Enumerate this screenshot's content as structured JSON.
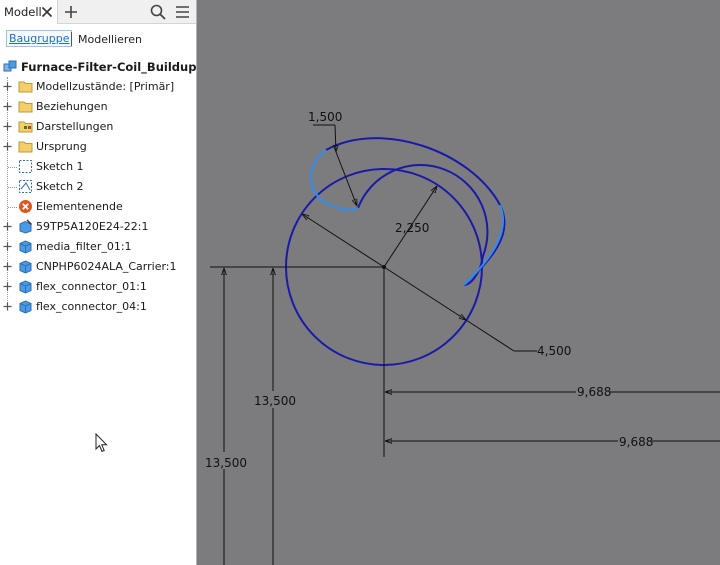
{
  "tabs": {
    "model_label": "Modell"
  },
  "modes": {
    "assembly_label": "Baugruppe",
    "model_label": "Modellieren"
  },
  "tree": {
    "root_label": "Furnace-Filter-Coil_Buildup.iam",
    "items": [
      {
        "label": "Modellzustände: [Primär]",
        "icon": "folder-icon",
        "expandable": true
      },
      {
        "label": "Beziehungen",
        "icon": "folder-icon",
        "expandable": true
      },
      {
        "label": "Darstellungen",
        "icon": "representations-folder-icon",
        "expandable": true
      },
      {
        "label": "Ursprung",
        "icon": "folder-icon",
        "expandable": true
      },
      {
        "label": "Sketch 1",
        "icon": "sketch-icon",
        "expandable": false
      },
      {
        "label": "Sketch 2",
        "icon": "sketch-icon",
        "expandable": false
      },
      {
        "label": "Elementenende",
        "icon": "end-of-features-icon",
        "expandable": false
      },
      {
        "label": "59TP5A120E24-22:1",
        "icon": "edited-part-icon",
        "expandable": true
      },
      {
        "label": "media_filter_01:1",
        "icon": "part-icon",
        "expandable": true
      },
      {
        "label": "CNPHP6024ALA_Carrier:1",
        "icon": "part-icon",
        "expandable": true
      },
      {
        "label": "flex_connector_01:1",
        "icon": "part-icon",
        "expandable": true
      },
      {
        "label": "flex_connector_04:1",
        "icon": "part-icon",
        "expandable": true
      }
    ]
  },
  "sketch": {
    "dimensions": {
      "slot_width": "1,500",
      "inner_radius": "2,250",
      "outer_diameter": "4,500",
      "vertical_a": "13,500",
      "vertical_b": "13,500",
      "horizontal_a": "9,688",
      "horizontal_b": "9,688"
    }
  },
  "colors": {
    "canvas": "#7c7c7f",
    "sketch_blue": "#1a1aa8",
    "highlight_blue": "#2f8ef0",
    "dim_line": "#111111",
    "folder": "#f2cf6b",
    "part": "#4a9be6",
    "link": "#1a6fd1"
  }
}
